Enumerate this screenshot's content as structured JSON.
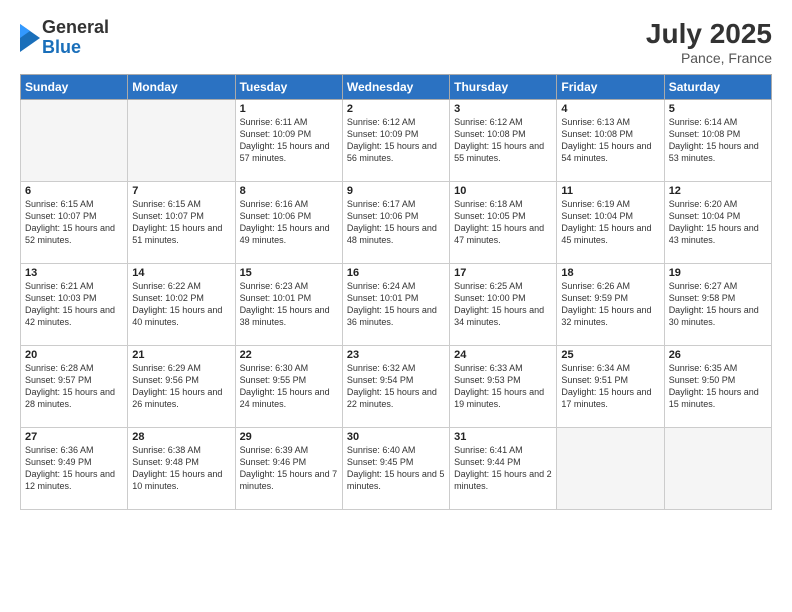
{
  "logo": {
    "general": "General",
    "blue": "Blue"
  },
  "header": {
    "month_year": "July 2025",
    "location": "Pance, France"
  },
  "days_of_week": [
    "Sunday",
    "Monday",
    "Tuesday",
    "Wednesday",
    "Thursday",
    "Friday",
    "Saturday"
  ],
  "weeks": [
    [
      {
        "day": "",
        "sunrise": "",
        "sunset": "",
        "daylight": ""
      },
      {
        "day": "",
        "sunrise": "",
        "sunset": "",
        "daylight": ""
      },
      {
        "day": "1",
        "sunrise": "Sunrise: 6:11 AM",
        "sunset": "Sunset: 10:09 PM",
        "daylight": "Daylight: 15 hours and 57 minutes."
      },
      {
        "day": "2",
        "sunrise": "Sunrise: 6:12 AM",
        "sunset": "Sunset: 10:09 PM",
        "daylight": "Daylight: 15 hours and 56 minutes."
      },
      {
        "day": "3",
        "sunrise": "Sunrise: 6:12 AM",
        "sunset": "Sunset: 10:08 PM",
        "daylight": "Daylight: 15 hours and 55 minutes."
      },
      {
        "day": "4",
        "sunrise": "Sunrise: 6:13 AM",
        "sunset": "Sunset: 10:08 PM",
        "daylight": "Daylight: 15 hours and 54 minutes."
      },
      {
        "day": "5",
        "sunrise": "Sunrise: 6:14 AM",
        "sunset": "Sunset: 10:08 PM",
        "daylight": "Daylight: 15 hours and 53 minutes."
      }
    ],
    [
      {
        "day": "6",
        "sunrise": "Sunrise: 6:15 AM",
        "sunset": "Sunset: 10:07 PM",
        "daylight": "Daylight: 15 hours and 52 minutes."
      },
      {
        "day": "7",
        "sunrise": "Sunrise: 6:15 AM",
        "sunset": "Sunset: 10:07 PM",
        "daylight": "Daylight: 15 hours and 51 minutes."
      },
      {
        "day": "8",
        "sunrise": "Sunrise: 6:16 AM",
        "sunset": "Sunset: 10:06 PM",
        "daylight": "Daylight: 15 hours and 49 minutes."
      },
      {
        "day": "9",
        "sunrise": "Sunrise: 6:17 AM",
        "sunset": "Sunset: 10:06 PM",
        "daylight": "Daylight: 15 hours and 48 minutes."
      },
      {
        "day": "10",
        "sunrise": "Sunrise: 6:18 AM",
        "sunset": "Sunset: 10:05 PM",
        "daylight": "Daylight: 15 hours and 47 minutes."
      },
      {
        "day": "11",
        "sunrise": "Sunrise: 6:19 AM",
        "sunset": "Sunset: 10:04 PM",
        "daylight": "Daylight: 15 hours and 45 minutes."
      },
      {
        "day": "12",
        "sunrise": "Sunrise: 6:20 AM",
        "sunset": "Sunset: 10:04 PM",
        "daylight": "Daylight: 15 hours and 43 minutes."
      }
    ],
    [
      {
        "day": "13",
        "sunrise": "Sunrise: 6:21 AM",
        "sunset": "Sunset: 10:03 PM",
        "daylight": "Daylight: 15 hours and 42 minutes."
      },
      {
        "day": "14",
        "sunrise": "Sunrise: 6:22 AM",
        "sunset": "Sunset: 10:02 PM",
        "daylight": "Daylight: 15 hours and 40 minutes."
      },
      {
        "day": "15",
        "sunrise": "Sunrise: 6:23 AM",
        "sunset": "Sunset: 10:01 PM",
        "daylight": "Daylight: 15 hours and 38 minutes."
      },
      {
        "day": "16",
        "sunrise": "Sunrise: 6:24 AM",
        "sunset": "Sunset: 10:01 PM",
        "daylight": "Daylight: 15 hours and 36 minutes."
      },
      {
        "day": "17",
        "sunrise": "Sunrise: 6:25 AM",
        "sunset": "Sunset: 10:00 PM",
        "daylight": "Daylight: 15 hours and 34 minutes."
      },
      {
        "day": "18",
        "sunrise": "Sunrise: 6:26 AM",
        "sunset": "Sunset: 9:59 PM",
        "daylight": "Daylight: 15 hours and 32 minutes."
      },
      {
        "day": "19",
        "sunrise": "Sunrise: 6:27 AM",
        "sunset": "Sunset: 9:58 PM",
        "daylight": "Daylight: 15 hours and 30 minutes."
      }
    ],
    [
      {
        "day": "20",
        "sunrise": "Sunrise: 6:28 AM",
        "sunset": "Sunset: 9:57 PM",
        "daylight": "Daylight: 15 hours and 28 minutes."
      },
      {
        "day": "21",
        "sunrise": "Sunrise: 6:29 AM",
        "sunset": "Sunset: 9:56 PM",
        "daylight": "Daylight: 15 hours and 26 minutes."
      },
      {
        "day": "22",
        "sunrise": "Sunrise: 6:30 AM",
        "sunset": "Sunset: 9:55 PM",
        "daylight": "Daylight: 15 hours and 24 minutes."
      },
      {
        "day": "23",
        "sunrise": "Sunrise: 6:32 AM",
        "sunset": "Sunset: 9:54 PM",
        "daylight": "Daylight: 15 hours and 22 minutes."
      },
      {
        "day": "24",
        "sunrise": "Sunrise: 6:33 AM",
        "sunset": "Sunset: 9:53 PM",
        "daylight": "Daylight: 15 hours and 19 minutes."
      },
      {
        "day": "25",
        "sunrise": "Sunrise: 6:34 AM",
        "sunset": "Sunset: 9:51 PM",
        "daylight": "Daylight: 15 hours and 17 minutes."
      },
      {
        "day": "26",
        "sunrise": "Sunrise: 6:35 AM",
        "sunset": "Sunset: 9:50 PM",
        "daylight": "Daylight: 15 hours and 15 minutes."
      }
    ],
    [
      {
        "day": "27",
        "sunrise": "Sunrise: 6:36 AM",
        "sunset": "Sunset: 9:49 PM",
        "daylight": "Daylight: 15 hours and 12 minutes."
      },
      {
        "day": "28",
        "sunrise": "Sunrise: 6:38 AM",
        "sunset": "Sunset: 9:48 PM",
        "daylight": "Daylight: 15 hours and 10 minutes."
      },
      {
        "day": "29",
        "sunrise": "Sunrise: 6:39 AM",
        "sunset": "Sunset: 9:46 PM",
        "daylight": "Daylight: 15 hours and 7 minutes."
      },
      {
        "day": "30",
        "sunrise": "Sunrise: 6:40 AM",
        "sunset": "Sunset: 9:45 PM",
        "daylight": "Daylight: 15 hours and 5 minutes."
      },
      {
        "day": "31",
        "sunrise": "Sunrise: 6:41 AM",
        "sunset": "Sunset: 9:44 PM",
        "daylight": "Daylight: 15 hours and 2 minutes."
      },
      {
        "day": "",
        "sunrise": "",
        "sunset": "",
        "daylight": ""
      },
      {
        "day": "",
        "sunrise": "",
        "sunset": "",
        "daylight": ""
      }
    ]
  ]
}
